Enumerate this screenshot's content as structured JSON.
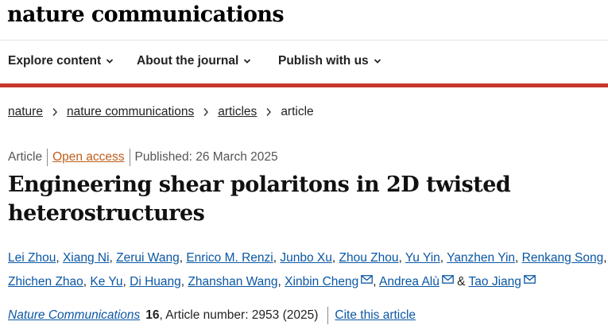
{
  "header": {
    "logo": "nature communications"
  },
  "nav": {
    "items": [
      {
        "label": "Explore content"
      },
      {
        "label": "About the journal"
      },
      {
        "label": "Publish with us"
      }
    ]
  },
  "colors": {
    "accent_bar": "#c8372d",
    "link": "#0b57a4",
    "open_access": "#c15d1a"
  },
  "breadcrumb": {
    "items": [
      "nature",
      "nature communications",
      "articles"
    ],
    "current": "article"
  },
  "article": {
    "type": "Article",
    "access": "Open access",
    "published": "Published: 26 March 2025",
    "title_line1": "Engineering shear polaritons in 2D twisted",
    "title_line2": "heterostructures",
    "authors": [
      "Lei Zhou",
      "Xiang Ni",
      "Zerui Wang",
      "Enrico M. Renzi",
      "Junbo Xu",
      "Zhou Zhou",
      "Yu Yin",
      "Yanzhen Yin",
      "Renkang Song",
      "Zhichen Zhao",
      "Ke Yu",
      "Di Huang",
      "Zhanshan Wang",
      "Xinbin Cheng",
      "Andrea Alù",
      "Tao Jiang"
    ],
    "amp": "&",
    "journal": "Nature Communications",
    "volume": "16",
    "article_number": ", Article number: 2953 (2025)",
    "cite_label": "Cite this article"
  },
  "icons": {
    "chevron": "chevron-down-icon",
    "separator": "chevron-right-icon",
    "mail": "mail-icon"
  }
}
